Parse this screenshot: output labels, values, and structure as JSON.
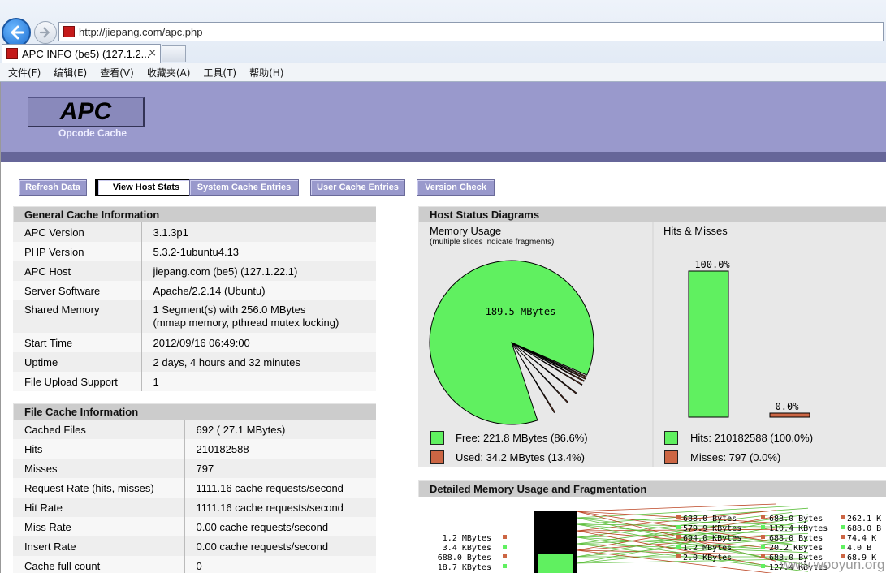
{
  "browser": {
    "url": "http://jiepang.com/apc.php",
    "tab_title": "APC INFO (be5) (127.1.2...",
    "tab_close": "×",
    "menu": [
      "文件(F)",
      "编辑(E)",
      "查看(V)",
      "收藏夹(A)",
      "工具(T)",
      "帮助(H)"
    ]
  },
  "header": {
    "logo": "APC",
    "subtitle": "Opcode Cache"
  },
  "nav": [
    {
      "label": "Refresh Data",
      "active": false
    },
    {
      "label": "View Host Stats",
      "active": true
    },
    {
      "label": "System Cache Entries",
      "active": false
    },
    {
      "label": "User Cache Entries",
      "active": false
    },
    {
      "label": "Version Check",
      "active": false
    }
  ],
  "general": {
    "title": "General Cache Information",
    "rows": [
      [
        "APC Version",
        "3.1.3p1"
      ],
      [
        "PHP Version",
        "5.3.2-1ubuntu4.13"
      ],
      [
        "APC Host",
        "jiepang.com (be5) (127.1.22.1)"
      ],
      [
        "Server Software",
        "Apache/2.2.14 (Ubuntu)"
      ],
      [
        "Shared Memory",
        "1 Segment(s) with 256.0 MBytes",
        "(mmap memory, pthread mutex locking)"
      ],
      [
        "Start Time",
        "2012/09/16 06:49:00"
      ],
      [
        "Uptime",
        "2 days, 4 hours and 32 minutes"
      ],
      [
        "File Upload Support",
        "1"
      ]
    ]
  },
  "file_cache": {
    "title": "File Cache Information",
    "rows": [
      [
        "Cached Files",
        "692 ( 27.1 MBytes)"
      ],
      [
        "Hits",
        "210182588"
      ],
      [
        "Misses",
        "797"
      ],
      [
        "Request Rate (hits, misses)",
        "1111.16 cache requests/second"
      ],
      [
        "Hit Rate",
        "1111.16 cache requests/second"
      ],
      [
        "Miss Rate",
        "0.00 cache requests/second"
      ],
      [
        "Insert Rate",
        "0.00 cache requests/second"
      ],
      [
        "Cache full count",
        "0"
      ]
    ]
  },
  "host_status": {
    "title": "Host Status Diagrams",
    "memory": {
      "heading": "Memory Usage",
      "note": "(multiple slices indicate fragments)",
      "pie_label": "189.5 MBytes",
      "free_label": "Free: 221.8 MBytes (86.6%)",
      "used_label": "Used: 34.2 MBytes (13.4%)"
    },
    "hits_misses": {
      "heading": "Hits & Misses",
      "hits_pct_label": "100.0%",
      "misses_pct_label": "0.0%",
      "hits_label": "Hits: 210182588 (100.0%)",
      "misses_label": "Misses: 797 (0.0%)"
    },
    "colors": {
      "free": "#60f060",
      "used": "#cc6644",
      "border": "#000000"
    }
  },
  "chart_data": [
    {
      "type": "pie",
      "title": "Memory Usage",
      "slices": [
        {
          "label": "Free",
          "value": 86.6,
          "color": "#60f060"
        },
        {
          "label": "Used",
          "value": 13.4,
          "color": "#cc6644"
        }
      ]
    },
    {
      "type": "bar",
      "title": "Hits & Misses",
      "categories": [
        "Hits",
        "Misses"
      ],
      "values": [
        100.0,
        0.0
      ],
      "ylim": [
        0,
        100
      ]
    }
  ],
  "fragmentation": {
    "title": "Detailed Memory Usage and Fragmentation",
    "left_labels": [
      "1.2 MBytes",
      "3.4 KBytes",
      "688.0 Bytes",
      "18.7 KBytes"
    ],
    "col1_labels": [
      "688.0 Bytes",
      "579.9 KBytes",
      "694.0 KBytes",
      "1.2 MBytes",
      "2.0 KBytes"
    ],
    "col2_labels": [
      "688.0 Bytes",
      "110.4 KBytes",
      "688.0 Bytes",
      "20.2 KBytes",
      "688.0 Bytes",
      "127.4 KBytes"
    ],
    "col3_labels": [
      "262.1 K",
      "688.0 B",
      "74.4 K",
      "4.0 B",
      "68.9 K"
    ]
  },
  "watermark": "www.wooyun.org"
}
